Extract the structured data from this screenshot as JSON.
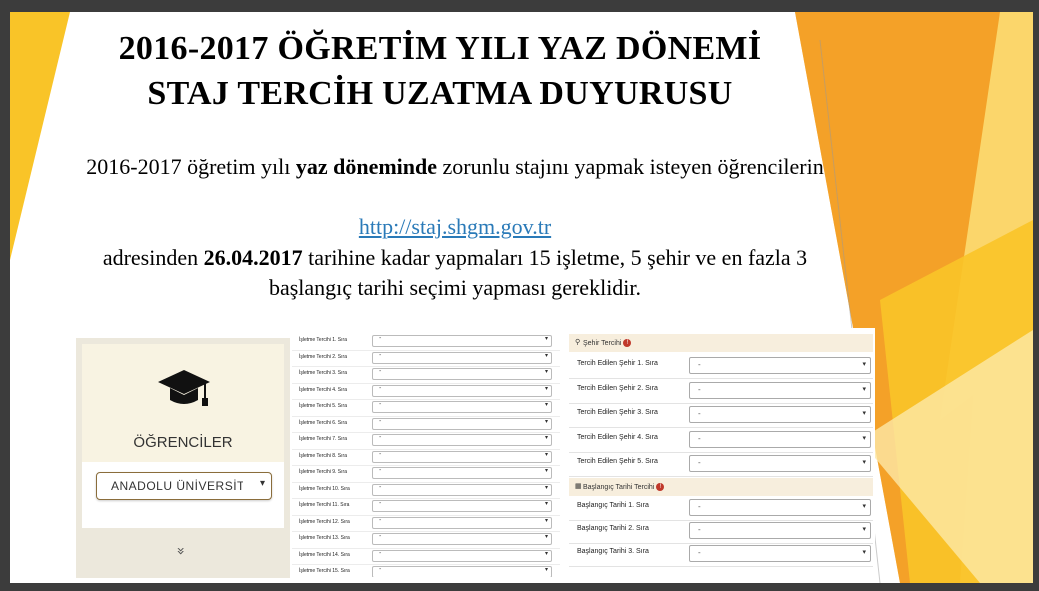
{
  "slide": {
    "title_line1": "2016-2017 ÖĞRETİM YILI YAZ DÖNEMİ",
    "title_line2": "STAJ TERCİH UZATMA DUYURUSU",
    "body": {
      "part1": "2016-2017 öğretim yılı ",
      "part1_bold": "yaz döneminde",
      "part2": " zorunlu stajını yapmak isteyen öğrencilerin",
      "link": "http://staj.shgm.gov.tr",
      "part3": "adresinden ",
      "date_bold": "26.04.2017",
      "part4": " tarihine kadar yapmaları 15 işletme, 5 şehir ve en fazla 3 başlangıç tarihi seçimi yapması gereklidir."
    },
    "colors": {
      "yellow": "#f9c428",
      "orange": "#f39a1d",
      "link": "#2a7ab8"
    }
  },
  "left_panel": {
    "icon": "graduation-cap-icon",
    "label": "ÖĞRENCİLER",
    "university_select": "ANADOLU ÜNİVERSİTESİ",
    "select_arrow": "▾",
    "expand_icon": "»"
  },
  "business_prefs": {
    "rows": [
      {
        "label": "İşletme Tercihi 1. Sıra",
        "value": "-"
      },
      {
        "label": "İşletme Tercihi 2. Sıra",
        "value": "-"
      },
      {
        "label": "İşletme Tercihi 3. Sıra",
        "value": "-"
      },
      {
        "label": "İşletme Tercihi 4. Sıra",
        "value": "-"
      },
      {
        "label": "İşletme Tercihi 5. Sıra",
        "value": "-"
      },
      {
        "label": "İşletme Tercihi 6. Sıra",
        "value": "-"
      },
      {
        "label": "İşletme Tercihi 7. Sıra",
        "value": "-"
      },
      {
        "label": "İşletme Tercihi 8. Sıra",
        "value": "-"
      },
      {
        "label": "İşletme Tercihi 9. Sıra",
        "value": "-"
      },
      {
        "label": "İşletme Tercihi 10. Sıra",
        "value": "-"
      },
      {
        "label": "İşletme Tercihi 11. Sıra",
        "value": "-"
      },
      {
        "label": "İşletme Tercihi 12. Sıra",
        "value": "-"
      },
      {
        "label": "İşletme Tercihi 13. Sıra",
        "value": "-"
      },
      {
        "label": "İşletme Tercihi 14. Sıra",
        "value": "-"
      },
      {
        "label": "İşletme Tercihi 15. Sıra",
        "value": "-"
      }
    ],
    "arrow": "▾"
  },
  "city_prefs": {
    "header": "Şehir Tercihi",
    "header_icon": "map-pin-icon",
    "badge": "!",
    "rows": [
      {
        "label": "Tercih Edilen Şehir 1. Sıra",
        "value": "-"
      },
      {
        "label": "Tercih Edilen Şehir 2. Sıra",
        "value": "-"
      },
      {
        "label": "Tercih Edilen Şehir 3. Sıra",
        "value": "-"
      },
      {
        "label": "Tercih Edilen Şehir 4. Sıra",
        "value": "-"
      },
      {
        "label": "Tercih Edilen Şehir 5. Sıra",
        "value": "-"
      }
    ]
  },
  "start_prefs": {
    "header": "Başlangıç Tarihi Tercihi",
    "header_icon": "calendar-icon",
    "badge": "!",
    "rows": [
      {
        "label": "Başlangıç Tarihi 1. Sıra",
        "value": "-"
      },
      {
        "label": "Başlangıç Tarihi 2. Sıra",
        "value": "-"
      },
      {
        "label": "Başlangıç Tarihi 3. Sıra",
        "value": "-"
      }
    ]
  }
}
